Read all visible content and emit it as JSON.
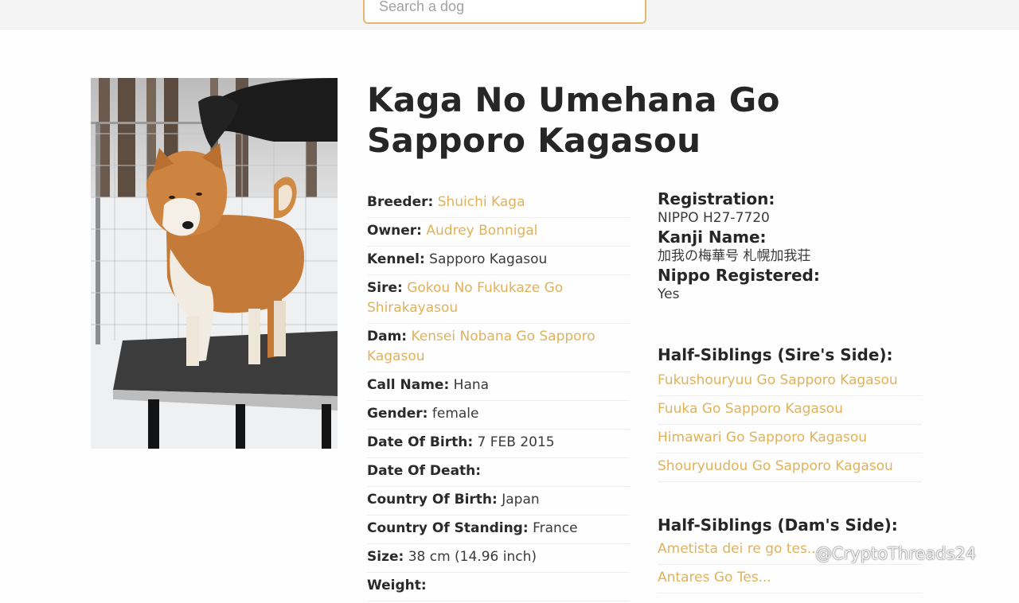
{
  "search": {
    "placeholder": "Search a dog"
  },
  "dog": {
    "name": "Kaga No Umehana Go Sapporo Kagasou"
  },
  "details": [
    {
      "label": "Breeder:",
      "value": "Shuichi Kaga",
      "link": true
    },
    {
      "label": "Owner:",
      "value": "Audrey Bonnigal",
      "link": true
    },
    {
      "label": "Kennel:",
      "value": "Sapporo Kagasou",
      "link": false
    },
    {
      "label": "Sire:",
      "value": "Gokou No Fukukaze Go Shirakayasou",
      "link": true
    },
    {
      "label": "Dam:",
      "value": "Kensei Nobana Go Sapporo Kagasou",
      "link": true
    },
    {
      "label": "Call Name:",
      "value": "Hana",
      "link": false
    },
    {
      "label": "Gender:",
      "value": "female",
      "link": false
    },
    {
      "label": "Date Of Birth:",
      "value": "7 FEB 2015",
      "link": false
    },
    {
      "label": "Date Of Death:",
      "value": "",
      "link": false
    },
    {
      "label": "Country Of Birth:",
      "value": "Japan",
      "link": false
    },
    {
      "label": "Country Of Standing:",
      "value": "France",
      "link": false
    },
    {
      "label": "Size:",
      "value": "38 cm (14.96 inch)",
      "link": false
    },
    {
      "label": "Weight:",
      "value": "",
      "link": false
    }
  ],
  "registration": {
    "label": "Registration:",
    "value": "NIPPO H27-7720"
  },
  "kanji": {
    "label": "Kanji Name:",
    "value": "加我の梅華号 札幌加我荘"
  },
  "nippo": {
    "label": "Nippo Registered:",
    "value": "Yes"
  },
  "half_siblings_sire": {
    "title": "Half-Siblings (Sire's Side):",
    "items": [
      "Fukushouryuu Go Sapporo Kagasou",
      "Fuuka Go Sapporo Kagasou",
      "Himawari Go Sapporo Kagasou",
      "Shouryuudou Go Sapporo Kagasou"
    ]
  },
  "half_siblings_dam": {
    "title": "Half-Siblings (Dam's Side):",
    "items": [
      "Ametista dei re go tes...",
      "Antares Go Tes..."
    ]
  },
  "watermark": "@CryptoThreads24",
  "colors": {
    "accent": "#e0b25c",
    "search_border": "#e8b66f",
    "heading": "#262626"
  }
}
